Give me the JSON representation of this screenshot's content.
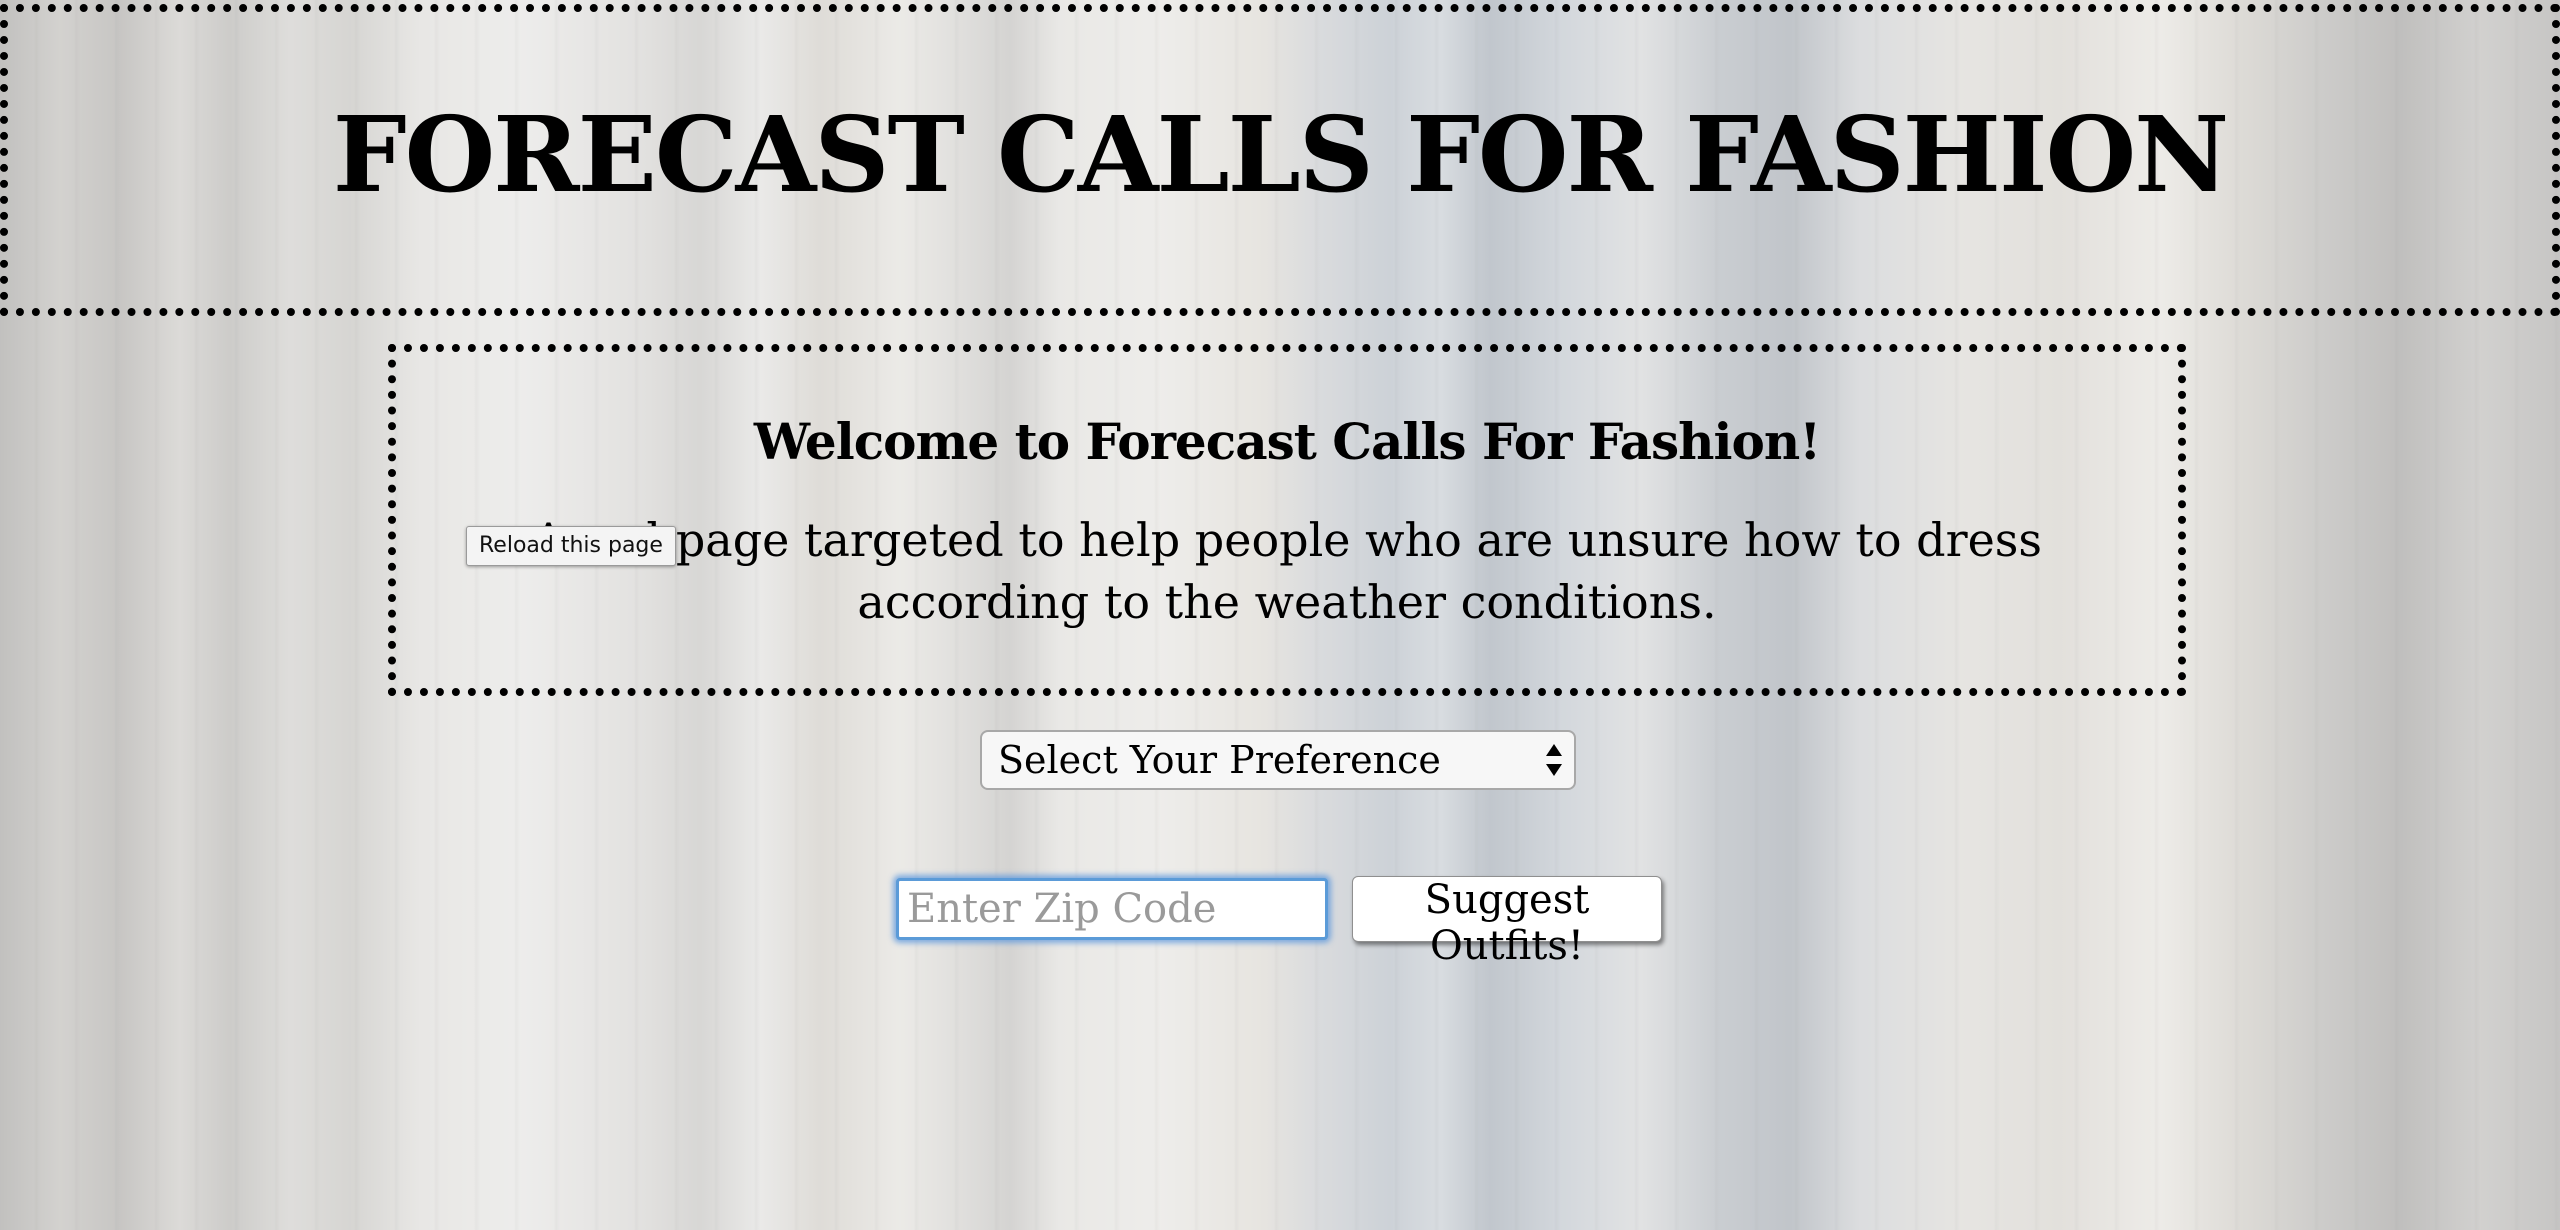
{
  "header": {
    "title": "FORECAST CALLS FOR FASHION"
  },
  "intro": {
    "heading": "Welcome to Forecast Calls For Fashion!",
    "description": "A webpage targeted to help people who are unsure how to dress according to the weather conditions."
  },
  "tooltip": {
    "text": "Reload this page"
  },
  "preference_select": {
    "selected": "Select Your Preference",
    "icon": "up-down-arrows-icon"
  },
  "zip": {
    "placeholder": "Enter Zip Code",
    "value": ""
  },
  "suggest_button": {
    "label": "Suggest Outfits!"
  },
  "colors": {
    "focus_ring": "#5b9bd8",
    "border": "#000000"
  }
}
